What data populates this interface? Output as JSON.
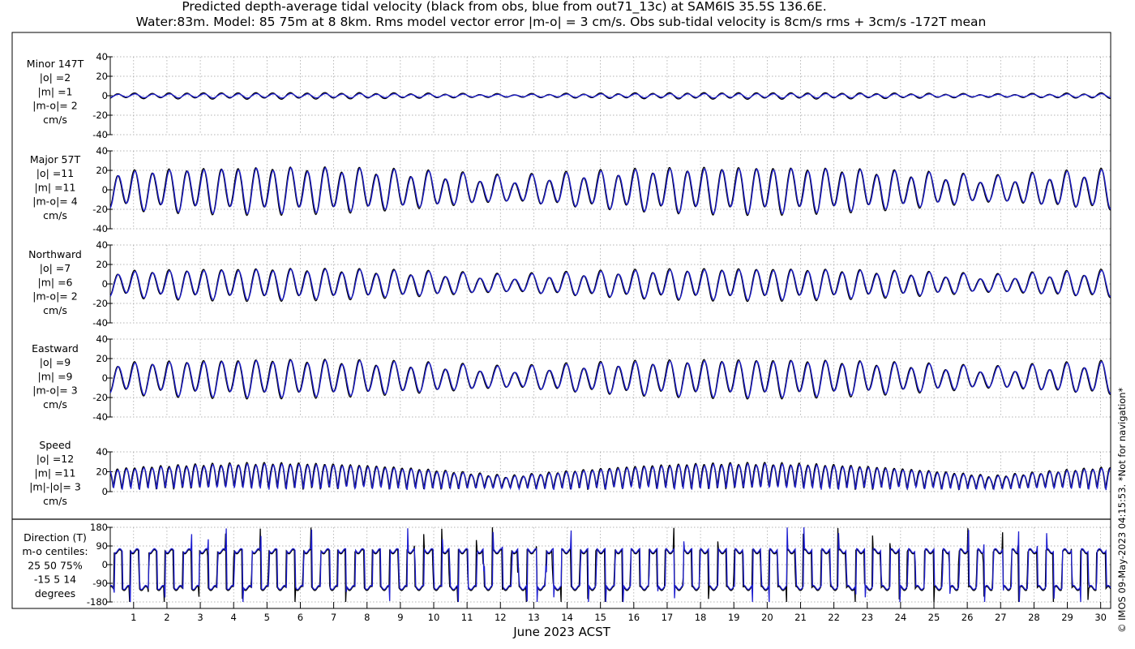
{
  "title_line1": "Predicted depth-average tidal velocity (black from obs, blue from out71_13c) at SAM6IS 35.5S 136.6E.",
  "title_line2": "Water:83m. Model: 85 75m at 8 8km. Rms model vector error |m-o| = 3 cm/s. Obs sub-tidal velocity is 8cm/s rms + 3cm/s -172T mean",
  "side_note": "© IMOS 09-May-2023 04:15:53. *Not for navigation*",
  "colors": {
    "obs": "#000000",
    "model": "#1f1fd0",
    "grid": "#9a9a9a"
  },
  "chart_data": [
    {
      "type": "line",
      "name": "minor",
      "label_lines": [
        "Minor 147T",
        "|o| =2",
        "|m| =1",
        "|m-o|= 2",
        "cm/s"
      ],
      "ylim": [
        -40,
        40
      ],
      "yticks": [
        -40,
        -20,
        0,
        20,
        40
      ],
      "tick_labels": [
        "-40",
        "-20",
        "0",
        "20",
        "40"
      ],
      "obs_amp": 3,
      "model_amp": 2,
      "series": [
        {
          "name": "obs"
        },
        {
          "name": "model"
        }
      ]
    },
    {
      "type": "line",
      "name": "major",
      "label_lines": [
        "Major 57T",
        "|o| =11",
        "|m| =11",
        "|m-o|= 4",
        "cm/s"
      ],
      "ylim": [
        -40,
        40
      ],
      "yticks": [
        -40,
        -20,
        0,
        20,
        40
      ],
      "tick_labels": [
        "-40",
        "-20",
        "0",
        "20",
        "40"
      ],
      "obs_amp": 22,
      "model_amp": 21,
      "series": [
        {
          "name": "obs"
        },
        {
          "name": "model"
        }
      ]
    },
    {
      "type": "line",
      "name": "northward",
      "label_lines": [
        "Northward",
        "|o| =7",
        "|m| =6",
        "|m-o|= 2",
        "cm/s"
      ],
      "ylim": [
        -40,
        40
      ],
      "yticks": [
        -40,
        -20,
        0,
        20,
        40
      ],
      "tick_labels": [
        "-40",
        "-20",
        "0",
        "20",
        "40"
      ],
      "obs_amp": 15,
      "model_amp": 14,
      "series": [
        {
          "name": "obs"
        },
        {
          "name": "model"
        }
      ]
    },
    {
      "type": "line",
      "name": "eastward",
      "label_lines": [
        "Eastward",
        "|o| =9",
        "|m| =9",
        "|m-o|= 3",
        "cm/s"
      ],
      "ylim": [
        -40,
        40
      ],
      "yticks": [
        -40,
        -20,
        0,
        20,
        40
      ],
      "tick_labels": [
        "-40",
        "-20",
        "0",
        "20",
        "40"
      ],
      "obs_amp": 18,
      "model_amp": 17,
      "series": [
        {
          "name": "obs"
        },
        {
          "name": "model"
        }
      ]
    },
    {
      "type": "line",
      "name": "speed",
      "label_lines": [
        "Speed",
        "|o| =12",
        "|m| =11",
        "|m|-|o|= 3",
        "cm/s"
      ],
      "ylim": [
        0,
        40
      ],
      "yticks": [
        0,
        20,
        40
      ],
      "tick_labels": [
        "0",
        "20",
        "40"
      ],
      "obs_amp": 26,
      "model_amp": 25,
      "series": [
        {
          "name": "obs"
        },
        {
          "name": "model"
        }
      ]
    },
    {
      "type": "line",
      "name": "direction",
      "label_lines": [
        "Direction (T)",
        "m-o centiles:",
        "25  50  75%",
        "-15   5  14",
        "degrees"
      ],
      "ylim": [
        -180,
        180
      ],
      "yticks": [
        -180,
        -90,
        0,
        90,
        180
      ],
      "tick_labels": [
        "-180",
        "-90",
        "0",
        "90",
        "180"
      ],
      "series": [
        {
          "name": "obs"
        },
        {
          "name": "model"
        }
      ]
    }
  ],
  "x_axis": {
    "xlim": [
      0.3,
      30.3
    ],
    "ticks": [
      1,
      2,
      3,
      4,
      5,
      6,
      7,
      8,
      9,
      10,
      11,
      12,
      13,
      14,
      15,
      16,
      17,
      18,
      19,
      20,
      21,
      22,
      23,
      24,
      25,
      26,
      27,
      28,
      29,
      30
    ],
    "tick_labels": [
      "1",
      "2",
      "3",
      "4",
      "5",
      "6",
      "7",
      "8",
      "9",
      "10",
      "11",
      "12",
      "13",
      "14",
      "15",
      "16",
      "17",
      "18",
      "19",
      "20",
      "21",
      "22",
      "23",
      "24",
      "25",
      "26",
      "27",
      "28",
      "29",
      "30"
    ],
    "label": "June 2023 ACST"
  }
}
